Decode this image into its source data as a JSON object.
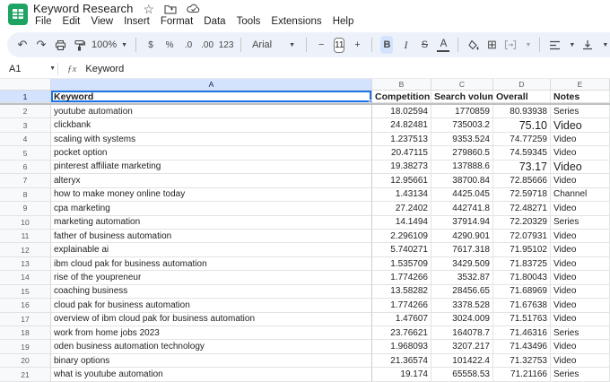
{
  "titlebar": {
    "title": "Keyword Research",
    "icons": [
      "star-icon",
      "move-folder-icon",
      "cloud-status-icon"
    ],
    "menus": [
      {
        "label": "File"
      },
      {
        "label": "Edit"
      },
      {
        "label": "View"
      },
      {
        "label": "Insert"
      },
      {
        "label": "Format"
      },
      {
        "label": "Data"
      },
      {
        "label": "Tools"
      },
      {
        "label": "Extensions"
      },
      {
        "label": "Help"
      }
    ]
  },
  "toolbar": {
    "zoom_label": "100%",
    "currency_label": "$",
    "percent_label": "%",
    "decrease_decimal_label": ".0",
    "increase_decimal_label": ".00",
    "more_formats_label": "123",
    "font_name": "Arial",
    "font_size": "11",
    "bold_label": "B",
    "italic_label": "I",
    "strikethrough_label": "S",
    "text_color_label": "A",
    "borders_glyph": "⊞",
    "undo_glyph": "↶",
    "redo_glyph": "↷"
  },
  "formula_bar": {
    "cell_ref": "A1",
    "formula": "Keyword"
  },
  "grid": {
    "column_headers": [
      "A",
      "B",
      "C",
      "D",
      "E"
    ],
    "header_row": {
      "n": "1",
      "keyword": "Keyword",
      "competition": "Competition",
      "volume": "Search volume",
      "overall": "Overall",
      "notes": "Notes"
    },
    "rows": [
      {
        "n": "2",
        "keyword": "youtube automation",
        "competition": "18.02594",
        "volume": "1770859",
        "overall": "80.93938",
        "notes": "Series",
        "large": false
      },
      {
        "n": "3",
        "keyword": "clickbank",
        "competition": "24.82481",
        "volume": "735003.2",
        "overall": "75.10",
        "notes": "Video",
        "large": true
      },
      {
        "n": "4",
        "keyword": "scaling with systems",
        "competition": "1.237513",
        "volume": "9353.524",
        "overall": "74.77259",
        "notes": "Video",
        "large": false
      },
      {
        "n": "5",
        "keyword": "pocket option",
        "competition": "20.47115",
        "volume": "279860.5",
        "overall": "74.59345",
        "notes": "Video",
        "large": false
      },
      {
        "n": "6",
        "keyword": "pinterest affiliate marketing",
        "competition": "19.38273",
        "volume": "137888.6",
        "overall": "73.17",
        "notes": "Video",
        "large": true
      },
      {
        "n": "7",
        "keyword": "alteryx",
        "competition": "12.95661",
        "volume": "38700.84",
        "overall": "72.85666",
        "notes": "Video",
        "large": false
      },
      {
        "n": "8",
        "keyword": "how to make money online today",
        "competition": "1.43134",
        "volume": "4425.045",
        "overall": "72.59718",
        "notes": "Channel",
        "large": false
      },
      {
        "n": "9",
        "keyword": "cpa marketing",
        "competition": "27.2402",
        "volume": "442741.8",
        "overall": "72.48271",
        "notes": "Video",
        "large": false
      },
      {
        "n": "10",
        "keyword": "marketing automation",
        "competition": "14.1494",
        "volume": "37914.94",
        "overall": "72.20329",
        "notes": "Series",
        "large": false
      },
      {
        "n": "11",
        "keyword": "father of business automation",
        "competition": "2.296109",
        "volume": "4290.901",
        "overall": "72.07931",
        "notes": "Video",
        "large": false
      },
      {
        "n": "12",
        "keyword": "explainable ai",
        "competition": "5.740271",
        "volume": "7617.318",
        "overall": "71.95102",
        "notes": "Video",
        "large": false
      },
      {
        "n": "13",
        "keyword": "ibm cloud pak for business automation",
        "competition": "1.535709",
        "volume": "3429.509",
        "overall": "71.83725",
        "notes": "Video",
        "large": false
      },
      {
        "n": "14",
        "keyword": "rise of the youpreneur",
        "competition": "1.774266",
        "volume": "3532.87",
        "overall": "71.80043",
        "notes": "Video",
        "large": false
      },
      {
        "n": "15",
        "keyword": "coaching business",
        "competition": "13.58282",
        "volume": "28456.65",
        "overall": "71.68969",
        "notes": "Video",
        "large": false
      },
      {
        "n": "16",
        "keyword": "cloud pak for business automation",
        "competition": "1.774266",
        "volume": "3378.528",
        "overall": "71.67638",
        "notes": "Video",
        "large": false
      },
      {
        "n": "17",
        "keyword": "overview of ibm cloud pak for business automation",
        "competition": "1.47607",
        "volume": "3024.009",
        "overall": "71.51763",
        "notes": "Video",
        "large": false
      },
      {
        "n": "18",
        "keyword": "work from home jobs 2023",
        "competition": "23.76621",
        "volume": "164078.7",
        "overall": "71.46316",
        "notes": "Series",
        "large": false
      },
      {
        "n": "19",
        "keyword": "oden business automation technology",
        "competition": "1.968093",
        "volume": "3207.217",
        "overall": "71.43496",
        "notes": "Video",
        "large": false
      },
      {
        "n": "20",
        "keyword": "binary options",
        "competition": "21.36574",
        "volume": "101422.4",
        "overall": "71.32753",
        "notes": "Video",
        "large": false
      },
      {
        "n": "21",
        "keyword": "what is youtube automation",
        "competition": "19.174",
        "volume": "65558.53",
        "overall": "71.21166",
        "notes": "Series",
        "large": false
      }
    ]
  },
  "colors": {
    "accent_blue": "#1a73e8",
    "selected_header_bg": "#d3e3fd",
    "toolbar_bg": "#edf2fa",
    "logo_green": "#1ea362"
  }
}
